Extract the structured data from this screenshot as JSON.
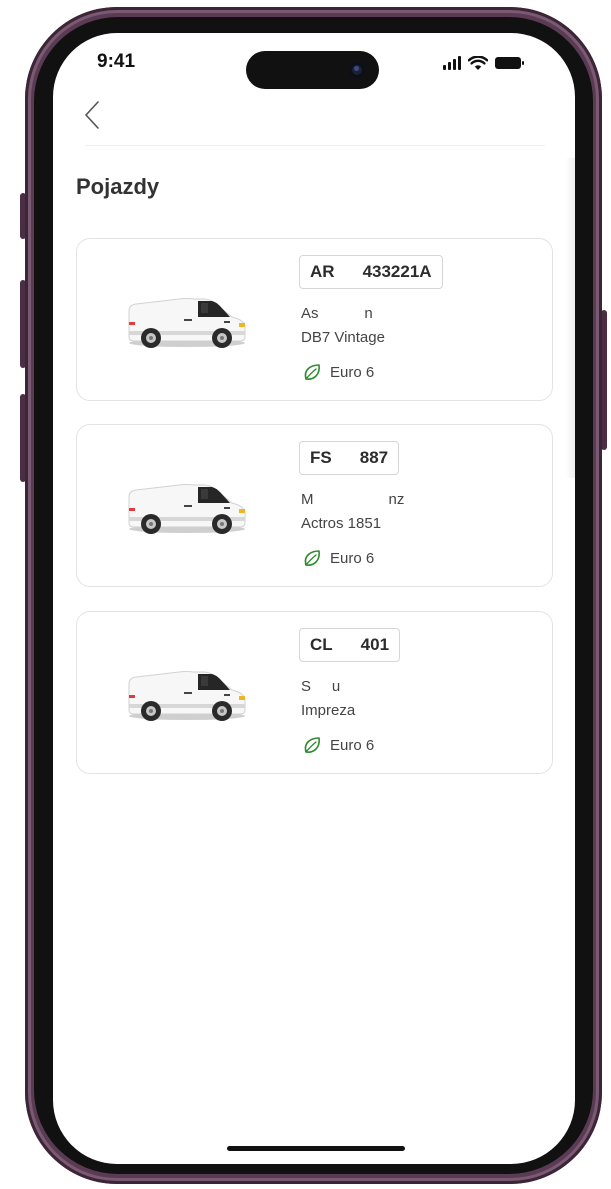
{
  "status_bar": {
    "time": "9:41"
  },
  "page": {
    "title": "Pojazdy"
  },
  "vehicles": [
    {
      "plate_prefix": "AR",
      "plate_number": "433221A",
      "make": "As           n",
      "model": "DB7 Vintage",
      "emission": "Euro 6"
    },
    {
      "plate_prefix": "FS",
      "plate_number": "887",
      "make": "M                  nz",
      "model": "Actros 1851",
      "emission": "Euro 6"
    },
    {
      "plate_prefix": "CL",
      "plate_number": "401",
      "make": "S     u",
      "model": "Impreza",
      "emission": "Euro 6"
    }
  ],
  "colors": {
    "eco_leaf": "#2e8b2e",
    "frame": "#5a3b53",
    "text": "#444444"
  },
  "icons": {
    "back": "chevron-left-icon",
    "emission": "leaf-icon",
    "vehicle": "van-icon"
  }
}
